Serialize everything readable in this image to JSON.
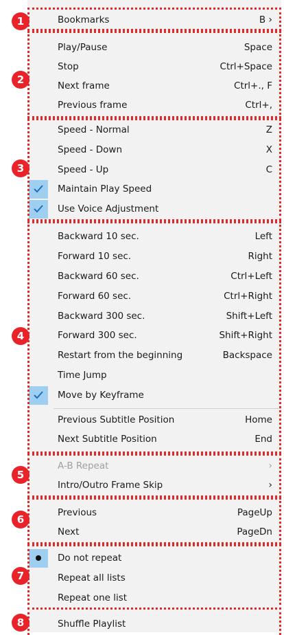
{
  "menu": {
    "bookmarks": {
      "label": "Bookmarks",
      "shortcut": "B",
      "arrow": "›"
    },
    "playback": [
      {
        "label": "Play/Pause",
        "shortcut": "Space"
      },
      {
        "label": "Stop",
        "shortcut": "Ctrl+Space"
      },
      {
        "label": "Next frame",
        "shortcut": "Ctrl+., F"
      },
      {
        "label": "Previous frame",
        "shortcut": "Ctrl+,"
      }
    ],
    "speed": [
      {
        "label": "Speed - Normal",
        "shortcut": "Z"
      },
      {
        "label": "Speed - Down",
        "shortcut": "X"
      },
      {
        "label": "Speed - Up",
        "shortcut": "C"
      },
      {
        "label": "Maintain Play Speed",
        "checked": true
      },
      {
        "label": "Use Voice Adjustment",
        "checked": true
      }
    ],
    "seek": [
      {
        "label": "Backward 10 sec.",
        "shortcut": "Left"
      },
      {
        "label": "Forward 10 sec.",
        "shortcut": "Right"
      },
      {
        "label": "Backward 60 sec.",
        "shortcut": "Ctrl+Left"
      },
      {
        "label": "Forward 60 sec.",
        "shortcut": "Ctrl+Right"
      },
      {
        "label": "Backward 300 sec.",
        "shortcut": "Shift+Left"
      },
      {
        "label": "Forward 300 sec.",
        "shortcut": "Shift+Right"
      },
      {
        "label": "Restart from the beginning",
        "shortcut": "Backspace"
      },
      {
        "label": "Time Jump"
      },
      {
        "label": "Move by Keyframe",
        "checked": true
      }
    ],
    "subtitle": [
      {
        "label": "Previous Subtitle Position",
        "shortcut": "Home"
      },
      {
        "label": "Next Subtitle Position",
        "shortcut": "End"
      }
    ],
    "repeat_sub": [
      {
        "label": "A-B Repeat",
        "arrow": "›",
        "disabled": true
      },
      {
        "label": "Intro/Outro Frame Skip",
        "arrow": "›"
      }
    ],
    "playlist_nav": [
      {
        "label": "Previous",
        "shortcut": "PageUp"
      },
      {
        "label": "Next",
        "shortcut": "PageDn"
      }
    ],
    "repeat_mode": [
      {
        "label": "Do not repeat",
        "selected": true
      },
      {
        "label": "Repeat all lists"
      },
      {
        "label": "Repeat one list"
      }
    ],
    "shuffle": {
      "label": "Shuffle Playlist"
    }
  },
  "badges": [
    "1",
    "2",
    "3",
    "4",
    "5",
    "6",
    "7",
    "8"
  ],
  "colors": {
    "menu_bg": "#f2f2f2",
    "check_bg": "#9ecff0",
    "check_mark": "#1f6fbf",
    "annotation_red": "#e02a2a",
    "badge_red": "#e8232a"
  },
  "icons": {
    "check": "checkmark-icon",
    "bullet": "radio-bullet-icon",
    "submenu": "chevron-right-icon"
  }
}
